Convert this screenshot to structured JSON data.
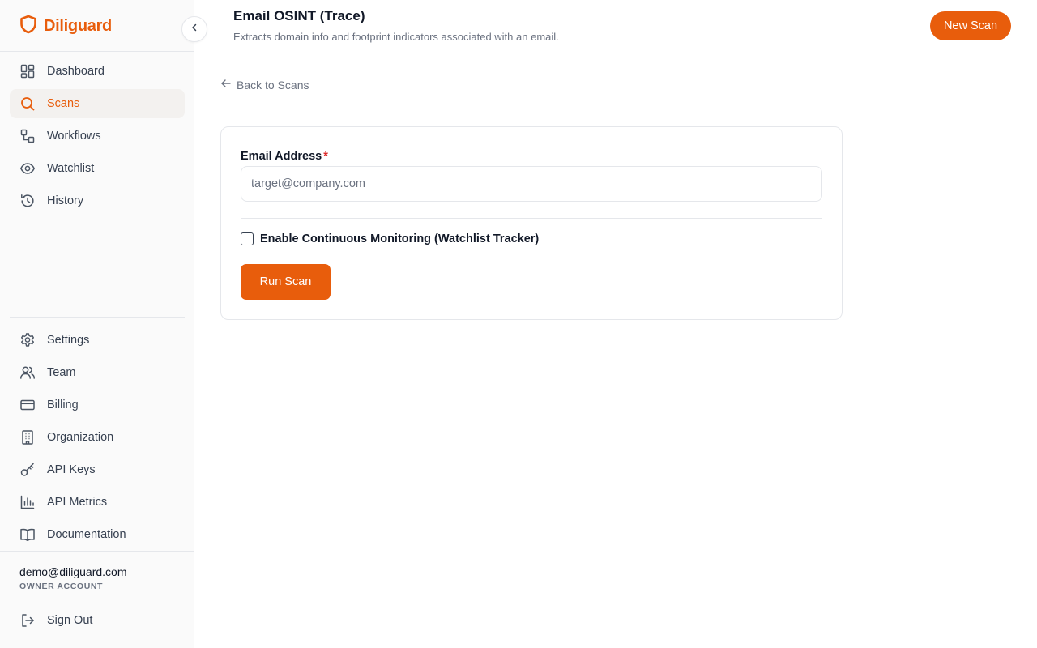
{
  "brand": {
    "name": "Diliguard",
    "color": "#e85d0c",
    "icon": "shield-icon"
  },
  "sidebar": {
    "main_items": [
      {
        "label": "Dashboard",
        "icon": "dashboard-grid-icon",
        "active": false
      },
      {
        "label": "Scans",
        "icon": "search-icon",
        "active": true
      },
      {
        "label": "Workflows",
        "icon": "workflow-icon",
        "active": false
      },
      {
        "label": "Watchlist",
        "icon": "eye-icon",
        "active": false
      },
      {
        "label": "History",
        "icon": "history-icon",
        "active": false
      }
    ],
    "bottom_items": [
      {
        "label": "Settings",
        "icon": "gear-icon"
      },
      {
        "label": "Team",
        "icon": "users-icon"
      },
      {
        "label": "Billing",
        "icon": "credit-card-icon"
      },
      {
        "label": "Organization",
        "icon": "building-icon"
      },
      {
        "label": "API Keys",
        "icon": "key-icon"
      },
      {
        "label": "API Metrics",
        "icon": "bar-chart-icon"
      },
      {
        "label": "Documentation",
        "icon": "book-icon"
      }
    ],
    "account": {
      "email": "demo@diliguard.com",
      "role": "OWNER ACCOUNT"
    },
    "sign_out_label": "Sign Out"
  },
  "header": {
    "title": "Email OSINT (Trace)",
    "subtitle": "Extracts domain info and footprint indicators associated with an email.",
    "new_scan_label": "New Scan"
  },
  "main": {
    "back_label": "Back to Scans",
    "form": {
      "email_label": "Email Address",
      "required_mark": "*",
      "email_placeholder": "target@company.com",
      "email_value": "",
      "monitoring_label": "Enable Continuous Monitoring (Watchlist Tracker)",
      "monitoring_checked": false,
      "run_label": "Run Scan"
    }
  },
  "colors": {
    "accent": "#e85d0c",
    "active_bg": "#f3f1ef",
    "border": "#e5e7eb",
    "required": "#dc2626"
  }
}
